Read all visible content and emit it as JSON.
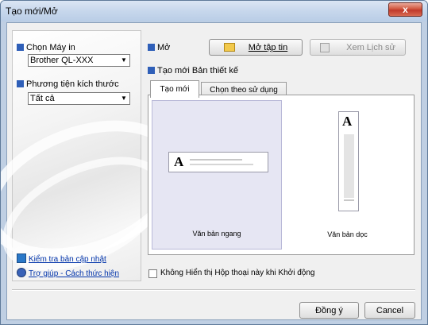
{
  "window": {
    "title": "Tạo mới/Mở",
    "close_label": "x"
  },
  "left": {
    "printer_label": "Chọn Máy in",
    "printer_value": "Brother QL-XXX",
    "media_label": "Phương tiện kích thước",
    "media_value": "Tất cả",
    "link_update": "Kiểm tra bản cập nhật",
    "link_help": "Trợ giúp - Cách thức hiện"
  },
  "open": {
    "label": "Mở",
    "open_file_button": "Mở tập tin",
    "history_button": "Xem Lịch sử"
  },
  "create": {
    "label": "Tạo mới Bản thiết kế",
    "tabs": [
      "Tạo mới",
      "Chọn theo sử dụng"
    ],
    "landscape_label": "Văn bản ngang",
    "portrait_label": "Văn bản dọc",
    "sample_glyph": "A"
  },
  "checkbox_label": "Không Hiển thị Hộp thoại này khi Khởi động",
  "footer": {
    "ok_button": "Đồng ý",
    "cancel_button": "Cancel"
  },
  "colors": {
    "accent_square": "#2f5fb8",
    "selected_pane": "#e6e6f3",
    "close_button": "#c0392b"
  }
}
